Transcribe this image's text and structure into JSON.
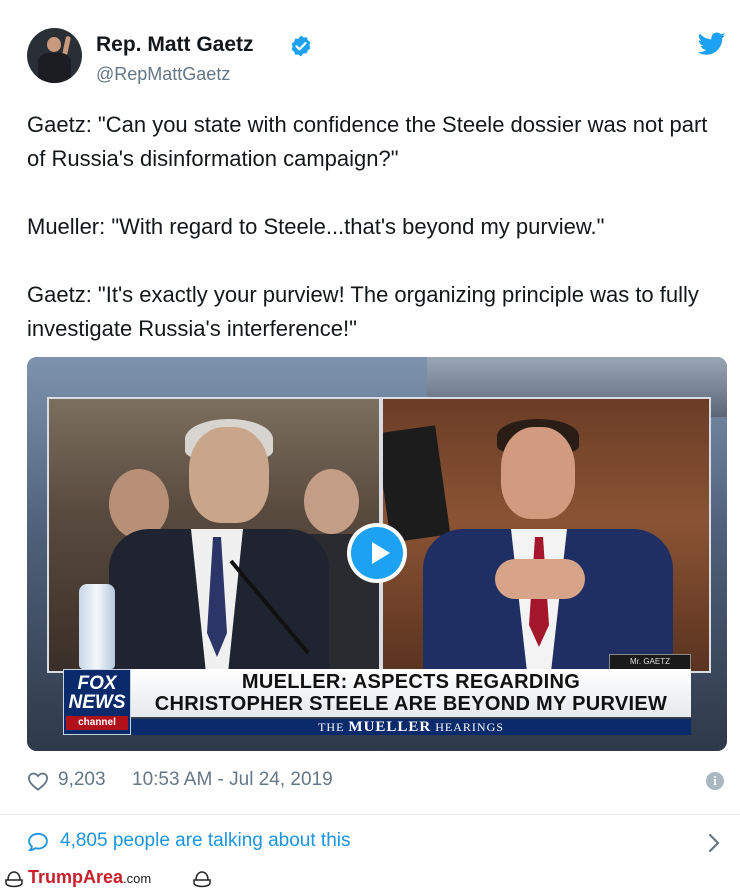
{
  "author": {
    "name": "Rep. Matt Gaetz",
    "handle": "@RepMattGaetz",
    "verified": true,
    "avatar_icon": "profile-photo",
    "platform_icon": "twitter-bird-icon"
  },
  "tweet": {
    "paragraphs": [
      "Gaetz: \"Can you state with confidence the Steele dossier was not part of Russia's disinformation campaign?\"",
      "Mueller: \"With regard to Steele...that's beyond my purview.\"",
      "Gaetz: \"It's exactly your purview! The organizing principle was to fully investigate Russia's interference!\""
    ]
  },
  "video": {
    "fox_logo_line1": "FOX",
    "fox_logo_line2": "NEWS",
    "fox_logo_line3": "channel",
    "headline_line1": "MUELLER: ASPECTS REGARDING",
    "headline_line2": "CHRISTOPHER STEELE ARE BEYOND MY PURVIEW",
    "hearings_prefix": "THE",
    "hearings_main": "MUELLER",
    "hearings_suffix": "HEARINGS",
    "nameplate": "Mr. GAETZ",
    "play_icon": "play-icon"
  },
  "stats": {
    "likes": "9,203",
    "timestamp": "10:53 AM - Jul 24, 2019"
  },
  "talking": {
    "text": "4,805 people are talking about this"
  },
  "watermark": {
    "brand": "TrumpArea",
    "suffix": ".com"
  },
  "colors": {
    "link_blue": "#1b95e0",
    "twitter_blue": "#1da1f2",
    "muted_gray": "#657786",
    "fox_navy": "#0a2a6b",
    "fox_red": "#b0111b",
    "watermark_red": "#c8202b"
  }
}
